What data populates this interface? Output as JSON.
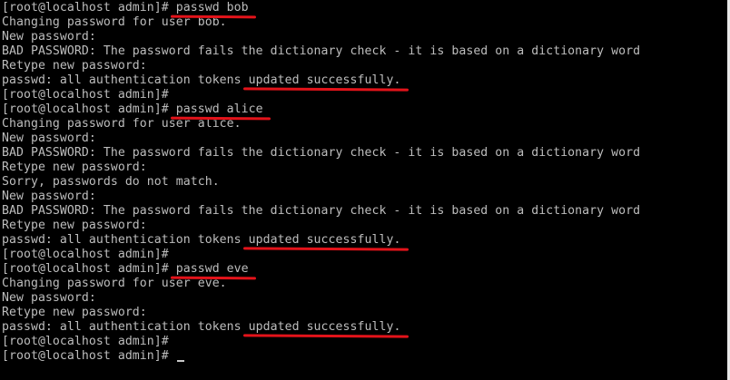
{
  "terminal": {
    "lines": [
      {
        "pre": "[root@localhost admin]# ",
        "hl": "passwd bob",
        "post": ""
      },
      {
        "pre": "Changing password for user bob.",
        "hl": "",
        "post": ""
      },
      {
        "pre": "New password:",
        "hl": "",
        "post": ""
      },
      {
        "pre": "BAD PASSWORD: The password fails the dictionary check - it is based on a dictionary word",
        "hl": "",
        "post": ""
      },
      {
        "pre": "Retype new password:",
        "hl": "",
        "post": ""
      },
      {
        "pre": "passwd: all authentication tokens ",
        "hl": "updated successfully.",
        "post": ""
      },
      {
        "pre": "[root@localhost admin]#",
        "hl": "",
        "post": ""
      },
      {
        "pre": "[root@localhost admin]# ",
        "hl": "passwd alice",
        "post": ""
      },
      {
        "pre": "Changing password for user alice.",
        "hl": "",
        "post": ""
      },
      {
        "pre": "New password:",
        "hl": "",
        "post": ""
      },
      {
        "pre": "BAD PASSWORD: The password fails the dictionary check - it is based on a dictionary word",
        "hl": "",
        "post": ""
      },
      {
        "pre": "Retype new password:",
        "hl": "",
        "post": ""
      },
      {
        "pre": "Sorry, passwords do not match.",
        "hl": "",
        "post": ""
      },
      {
        "pre": "New password:",
        "hl": "",
        "post": ""
      },
      {
        "pre": "BAD PASSWORD: The password fails the dictionary check - it is based on a dictionary word",
        "hl": "",
        "post": ""
      },
      {
        "pre": "Retype new password:",
        "hl": "",
        "post": ""
      },
      {
        "pre": "passwd: all authentication tokens ",
        "hl": "updated successfully.",
        "post": ""
      },
      {
        "pre": "[root@localhost admin]#",
        "hl": "",
        "post": ""
      },
      {
        "pre": "[root@localhost admin]# ",
        "hl": "passwd eve",
        "post": ""
      },
      {
        "pre": "Changing password for user eve.",
        "hl": "",
        "post": ""
      },
      {
        "pre": "New password:",
        "hl": "",
        "post": ""
      },
      {
        "pre": "Retype new password:",
        "hl": "",
        "post": ""
      },
      {
        "pre": "passwd: all authentication tokens ",
        "hl": "updated successfully.",
        "post": ""
      },
      {
        "pre": "[root@localhost admin]#",
        "hl": "",
        "post": ""
      },
      {
        "pre": "[root@localhost admin]# ",
        "hl": "",
        "post": "",
        "cursor": true
      }
    ],
    "colors": {
      "background": "#000000",
      "text": "#bdbdbd",
      "annotation": "#e3131a"
    }
  }
}
